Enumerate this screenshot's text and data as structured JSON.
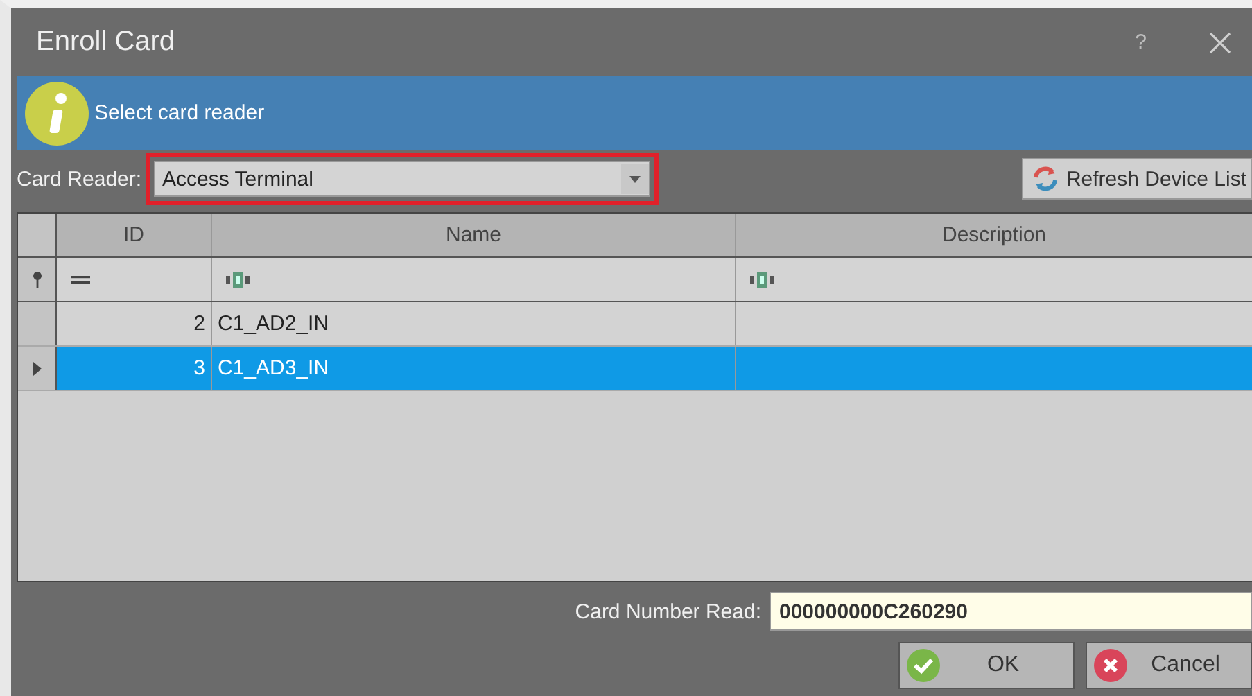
{
  "window": {
    "title": "Enroll Card",
    "help": "?"
  },
  "info": {
    "message": "Select card reader"
  },
  "card_reader": {
    "label": "Card Reader:",
    "value": "Access Terminal",
    "highlighted": true
  },
  "refresh_button": {
    "label": "Refresh Device List"
  },
  "table": {
    "columns": [
      "ID",
      "Name",
      "Description"
    ],
    "filters": [
      {
        "kind": "equals"
      },
      {
        "kind": "text"
      },
      {
        "kind": "text"
      }
    ],
    "rows": [
      {
        "id": "2",
        "name": "C1_AD2_IN",
        "selected": false
      },
      {
        "id": "3",
        "name": "C1_AD3_IN",
        "selected": true
      }
    ]
  },
  "card_number": {
    "label": "Card Number Read:",
    "value": "000000000C260290"
  },
  "buttons": [
    {
      "label": "OK",
      "kind": "ok"
    },
    {
      "label": "Cancel",
      "kind": "cancel"
    }
  ]
}
